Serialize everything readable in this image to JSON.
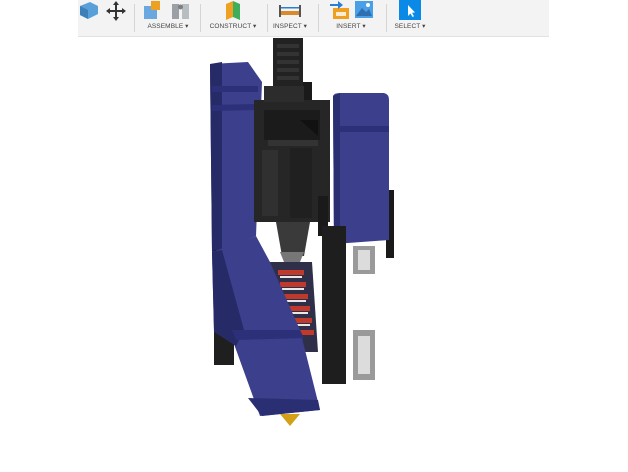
{
  "toolbar": {
    "groups": [
      {
        "name": "assemble",
        "label": "ASSEMBLE ▾",
        "icons": [
          "new-component-icon",
          "joint-icon"
        ]
      },
      {
        "name": "construct",
        "label": "CONSTRUCT ▾",
        "icons": [
          "offset-plane-icon"
        ]
      },
      {
        "name": "inspect",
        "label": "INSPECT ▾",
        "icons": [
          "measure-icon"
        ]
      },
      {
        "name": "insert",
        "label": "INSERT ▾",
        "icons": [
          "insert-derive-icon",
          "insert-image-icon"
        ]
      },
      {
        "name": "select",
        "label": "SELECT ▾",
        "icons": [
          "select-arrow-icon"
        ]
      }
    ],
    "leading_icons": [
      "box-icon",
      "move-icon"
    ]
  },
  "colors": {
    "part_blue": "#3b3f8c",
    "part_blue_dark": "#262a66",
    "part_black": "#1c1c1c",
    "accent_select": "#0a8ae6",
    "nozzle": "#d4a017",
    "coil": "#c0392b"
  }
}
